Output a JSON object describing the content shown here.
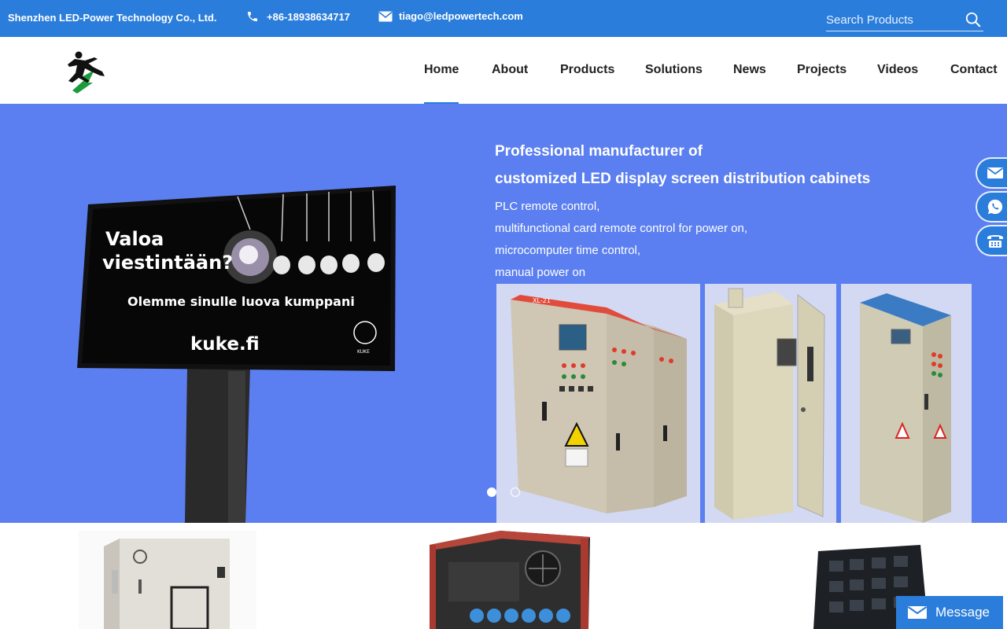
{
  "topbar": {
    "company": "Shenzhen LED-Power Technology Co., Ltd.",
    "phone": "+86-18938634717",
    "email": "tiago@ledpowertech.com",
    "search_placeholder": "Search Products",
    "phone_icon": "phone-icon",
    "email_icon": "envelope-icon",
    "search_icon": "search-icon"
  },
  "nav": {
    "items": [
      {
        "label": "Home",
        "active": true
      },
      {
        "label": "About"
      },
      {
        "label": "Products"
      },
      {
        "label": "Solutions"
      },
      {
        "label": "News"
      },
      {
        "label": "Projects"
      },
      {
        "label": "Videos"
      },
      {
        "label": "Contact"
      }
    ]
  },
  "hero": {
    "title_line1": "Professional manufacturer of",
    "title_line2": "customized LED display screen distribution cabinets",
    "features": [
      "PLC remote control,",
      "multifunctional card remote control for power on,",
      "microcomputer time control,",
      "manual power on"
    ],
    "billboard": {
      "headline1": "Valoa",
      "headline2": "viestintään?",
      "tagline": "Olemme sinulle luova kumppani",
      "site": "kuke.fi",
      "badge": "KUKE"
    },
    "cabinet_label": "XL-21",
    "slide_count": 2,
    "active_slide": 1
  },
  "side_buttons": [
    "email-icon",
    "whatsapp-icon",
    "telephone-icon"
  ],
  "message_button": {
    "label": "Message",
    "icon": "envelope-icon"
  },
  "colors": {
    "brand": "#2b7ddb",
    "hero_bg": "#5b7ff0",
    "text_dark": "#222222"
  }
}
